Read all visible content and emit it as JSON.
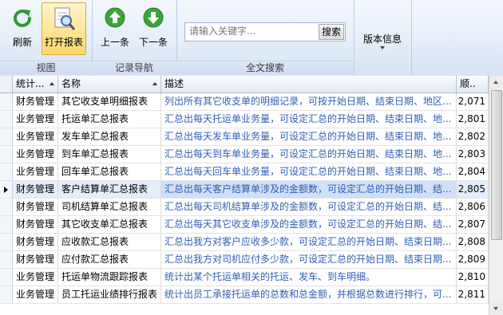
{
  "ribbon": {
    "groups": {
      "view": "视图",
      "nav": "记录导航",
      "search": "全文搜索"
    },
    "buttons": {
      "refresh": "刷新",
      "open_report": "打开报表",
      "prev": "上一条",
      "next": "下一条",
      "version": "版本信息"
    },
    "search": {
      "placeholder": "请输入关键字...",
      "button": "搜索"
    }
  },
  "grid": {
    "columns": {
      "category": "统计...",
      "name": "名称",
      "desc": "描述",
      "seq": "顺.."
    },
    "rows": [
      {
        "category": "财务管理",
        "name": "其它收支单明细报表",
        "desc": "列出所有其它收支单的明细记录，可按开始日期、结束日期、地区...",
        "seq": "2,071"
      },
      {
        "category": "业务管理",
        "name": "托运单汇总报表",
        "desc": "汇总出每天托运单业务量，可设定汇总的开始日期、结束日期、地...",
        "seq": "2,801"
      },
      {
        "category": "业务管理",
        "name": "发车单汇总报表",
        "desc": "汇总出每天发车单业务量，可设定汇总的开始日期、结束日期、地...",
        "seq": "2,802"
      },
      {
        "category": "业务管理",
        "name": "到车单汇总报表",
        "desc": "汇总出每天到车单业务量，可设定汇总的开始日期、结束日期、地...",
        "seq": "2,803"
      },
      {
        "category": "业务管理",
        "name": "回车单汇总报表",
        "desc": "汇总出每天回车单业务量，可设定汇总的开始日期、结束日期、地...",
        "seq": "2,804"
      },
      {
        "category": "财务管理",
        "name": "客户结算单汇总报表",
        "desc": "汇总出每天客户结算单涉及的金额数，可设定汇总的开始日期、结...",
        "seq": "2,805"
      },
      {
        "category": "财务管理",
        "name": "司机结算单汇总报表",
        "desc": "汇总出每天司机结算单涉及的金额数，可设定汇总的开始日期、结...",
        "seq": "2,806"
      },
      {
        "category": "财务管理",
        "name": "其它收支单汇总报表",
        "desc": "汇总出每天其它收支单涉及的金额数，可设定汇总的开始日期、结...",
        "seq": "2,807"
      },
      {
        "category": "财务管理",
        "name": "应收款汇总报表",
        "desc": "汇总出我方对客户应收多少款，可设定汇总的开始日期、结束日期...",
        "seq": "2,808"
      },
      {
        "category": "财务管理",
        "name": "应付款汇总报表",
        "desc": "汇总出我方对司机应付多少款，可设定汇总的开始日期、结束日期...",
        "seq": "2,809"
      },
      {
        "category": "业务管理",
        "name": "托运单物流跟踪报表",
        "desc": "统计出某个托运单相关的托运、发车、到车明细。",
        "seq": "2,810"
      },
      {
        "category": "业务管理",
        "name": "员工托运业绩排行报表",
        "desc": "统计出员工承接托运单的总数和总金额，并根据总数进行排行，可...",
        "seq": "2,811"
      }
    ]
  },
  "colors": {
    "desc_text": "#2f5fb3",
    "selected_row": "#e3eefc",
    "ribbon_bg": "#e3ecf8"
  }
}
